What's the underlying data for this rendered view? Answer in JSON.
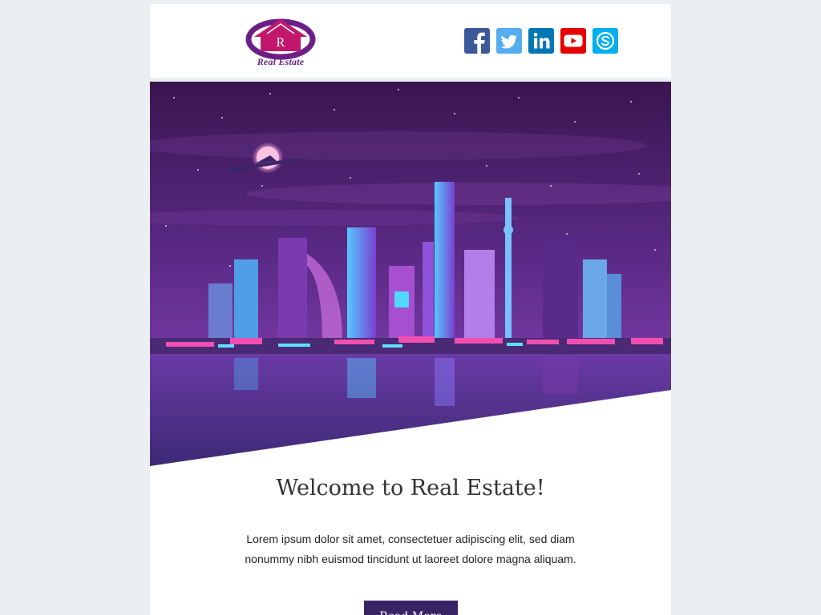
{
  "brand": {
    "logo_letter": "R",
    "logo_text": "Real Estate"
  },
  "social": [
    {
      "name": "facebook",
      "icon": "facebook-icon",
      "color": "#3b5998"
    },
    {
      "name": "twitter",
      "icon": "twitter-icon",
      "color": "#55acee"
    },
    {
      "name": "linkedin",
      "icon": "linkedin-icon",
      "color": "#0077b5"
    },
    {
      "name": "youtube",
      "icon": "youtube-icon",
      "color": "#e60000"
    },
    {
      "name": "skype",
      "icon": "skype-icon",
      "color": "#00aff0"
    }
  ],
  "hero": {
    "image": "neon-city-skyline-night"
  },
  "main": {
    "title": "Welcome to Real Estate!",
    "body": "Lorem ipsum dolor sit amet, consectetuer adipiscing elit, sed diam nonummy nibh euismod tincidunt ut laoreet dolore magna aliquam.",
    "cta_label": "Read More"
  },
  "colors": {
    "page_bg": "#ebeff1",
    "accent": "#3b2466",
    "brand_pink": "#c2186b",
    "brand_purple": "#6b1f86"
  }
}
